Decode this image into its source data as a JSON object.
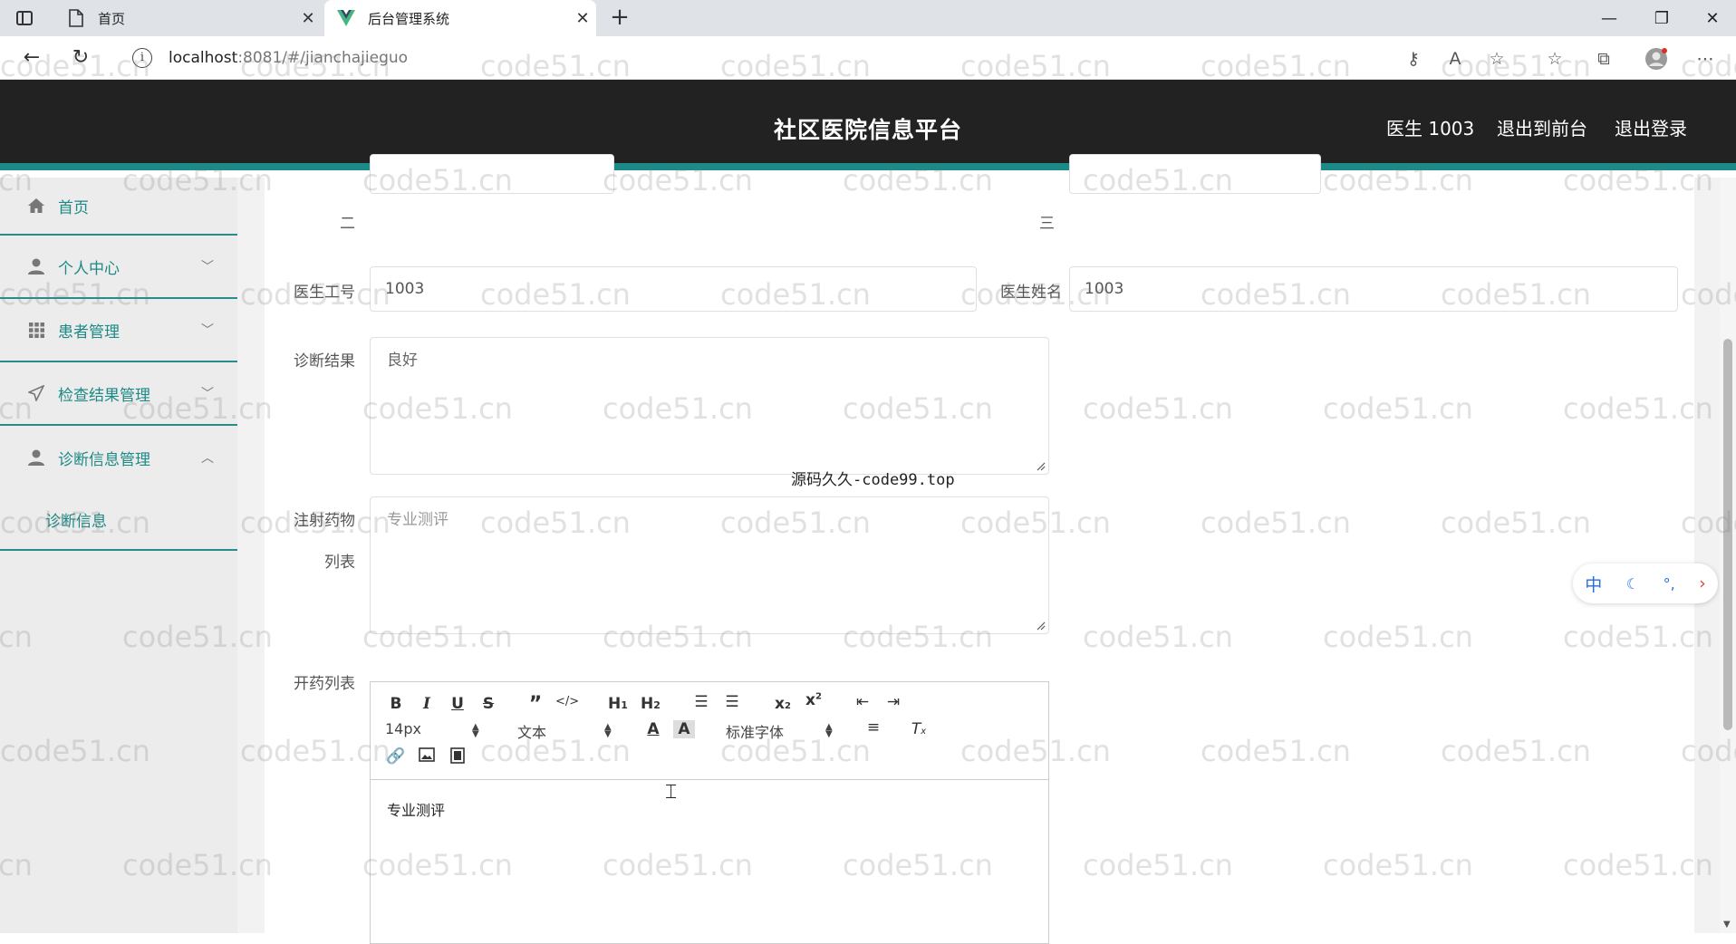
{
  "browser": {
    "tabs": [
      {
        "title": "首页"
      },
      {
        "title": "后台管理系统"
      }
    ],
    "url_host": "localhost",
    "url_rest": ":8081/#/jianchajieguo"
  },
  "header": {
    "title": "社区医院信息平台",
    "user": "医生 1003",
    "to_front": "退出到前台",
    "logout": "退出登录"
  },
  "sidebar": {
    "items": [
      {
        "label": "首页",
        "icon": "home-icon"
      },
      {
        "label": "个人中心",
        "icon": "user-icon"
      },
      {
        "label": "患者管理",
        "icon": "grid-icon"
      },
      {
        "label": "检查结果管理",
        "icon": "send-icon"
      },
      {
        "label": "诊断信息管理",
        "icon": "user-icon"
      }
    ],
    "sub_items": [
      {
        "label": "诊断信息"
      }
    ]
  },
  "form": {
    "partial_row_left_suffix": "二",
    "partial_row_right_suffix": "三",
    "doctor_id_label": "医生工号",
    "doctor_id_value": "1003",
    "doctor_name_label": "医生姓名",
    "doctor_name_value": "1003",
    "diagnosis_label": "诊断结果",
    "diagnosis_value": "良好",
    "injection_label_1": "注射药物",
    "injection_label_2": "列表",
    "injection_value": "专业测评",
    "prescription_label": "开药列表",
    "editor": {
      "font_size": "14px",
      "text_type": "文本",
      "font_family": "标准字体",
      "content": "专业测评"
    }
  },
  "overlay_note": "源码久久-code99.top",
  "ime_widget": {
    "lang": "中"
  },
  "watermark": "code51.cn"
}
